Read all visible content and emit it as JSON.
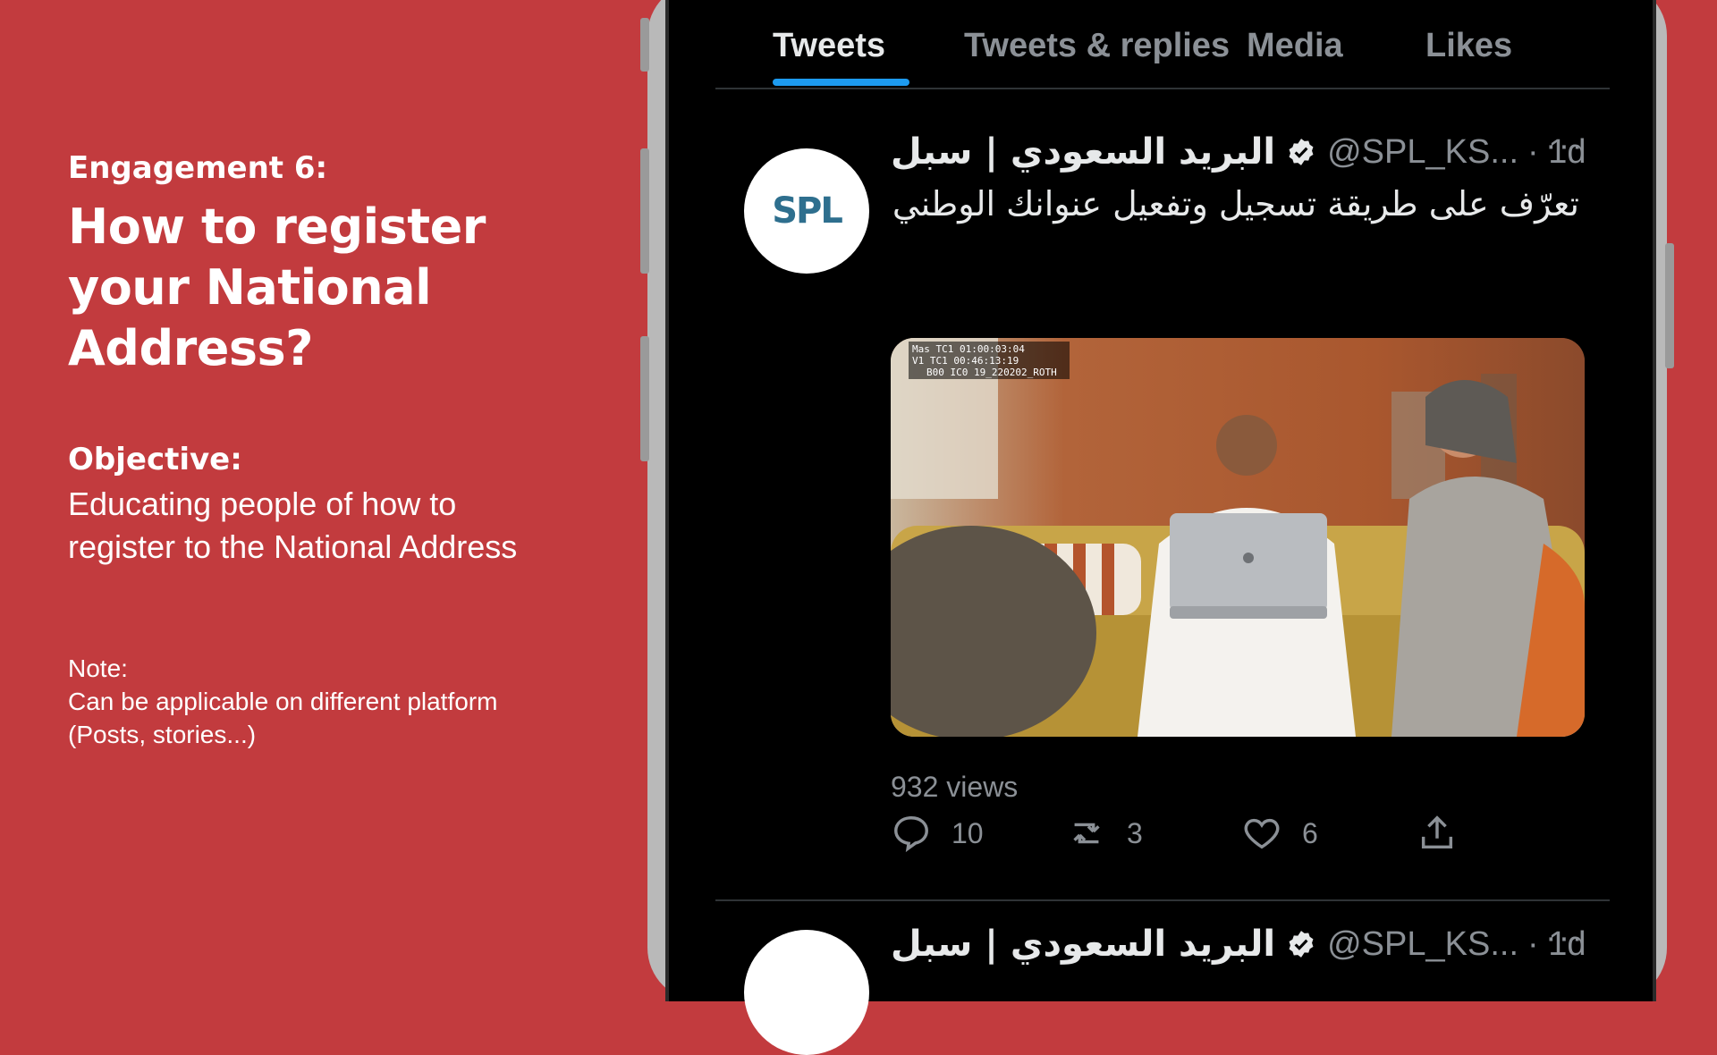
{
  "slide": {
    "engagement_label": "Engagement 6:",
    "headline": "How to register your National Address?",
    "objective_label": "Objective:",
    "objective_text": "Educating people of how to register to the National Address",
    "note_label": "Note:",
    "note_text": "Can be applicable on different platform (Posts, stories...)"
  },
  "profile_tabs": [
    {
      "label": "Tweets",
      "active": true
    },
    {
      "label": "Tweets & replies",
      "active": false
    },
    {
      "label": "Media",
      "active": false
    },
    {
      "label": "Likes",
      "active": false
    }
  ],
  "tweets": [
    {
      "avatar_text": "SPL",
      "display_name": "البريد السعودي | سبل",
      "handle": "@SPL_KS...",
      "time": "· 1d",
      "more": "···",
      "text": "تعرّف على طريقة تسجيل وتفعيل عنوانك الوطني",
      "video_timecode": [
        "Mas TC1  01:00:03:04",
        "V1 TC1  00:46:13:19",
        "B00 IC0 19_220202_ROTH"
      ],
      "views": "932 views",
      "replies": "10",
      "retweets": "3",
      "likes": "6"
    },
    {
      "display_name": "البريد السعودي | سبل",
      "handle": "@SPL_KS...",
      "time": "· 1d",
      "more": "···"
    }
  ],
  "colors": {
    "slide_background": "#c23b3e",
    "screen_background": "#000000",
    "active_tab_indicator": "#1d9bf0",
    "muted_text": "#8b9096",
    "primary_text": "#e7e9ea"
  }
}
